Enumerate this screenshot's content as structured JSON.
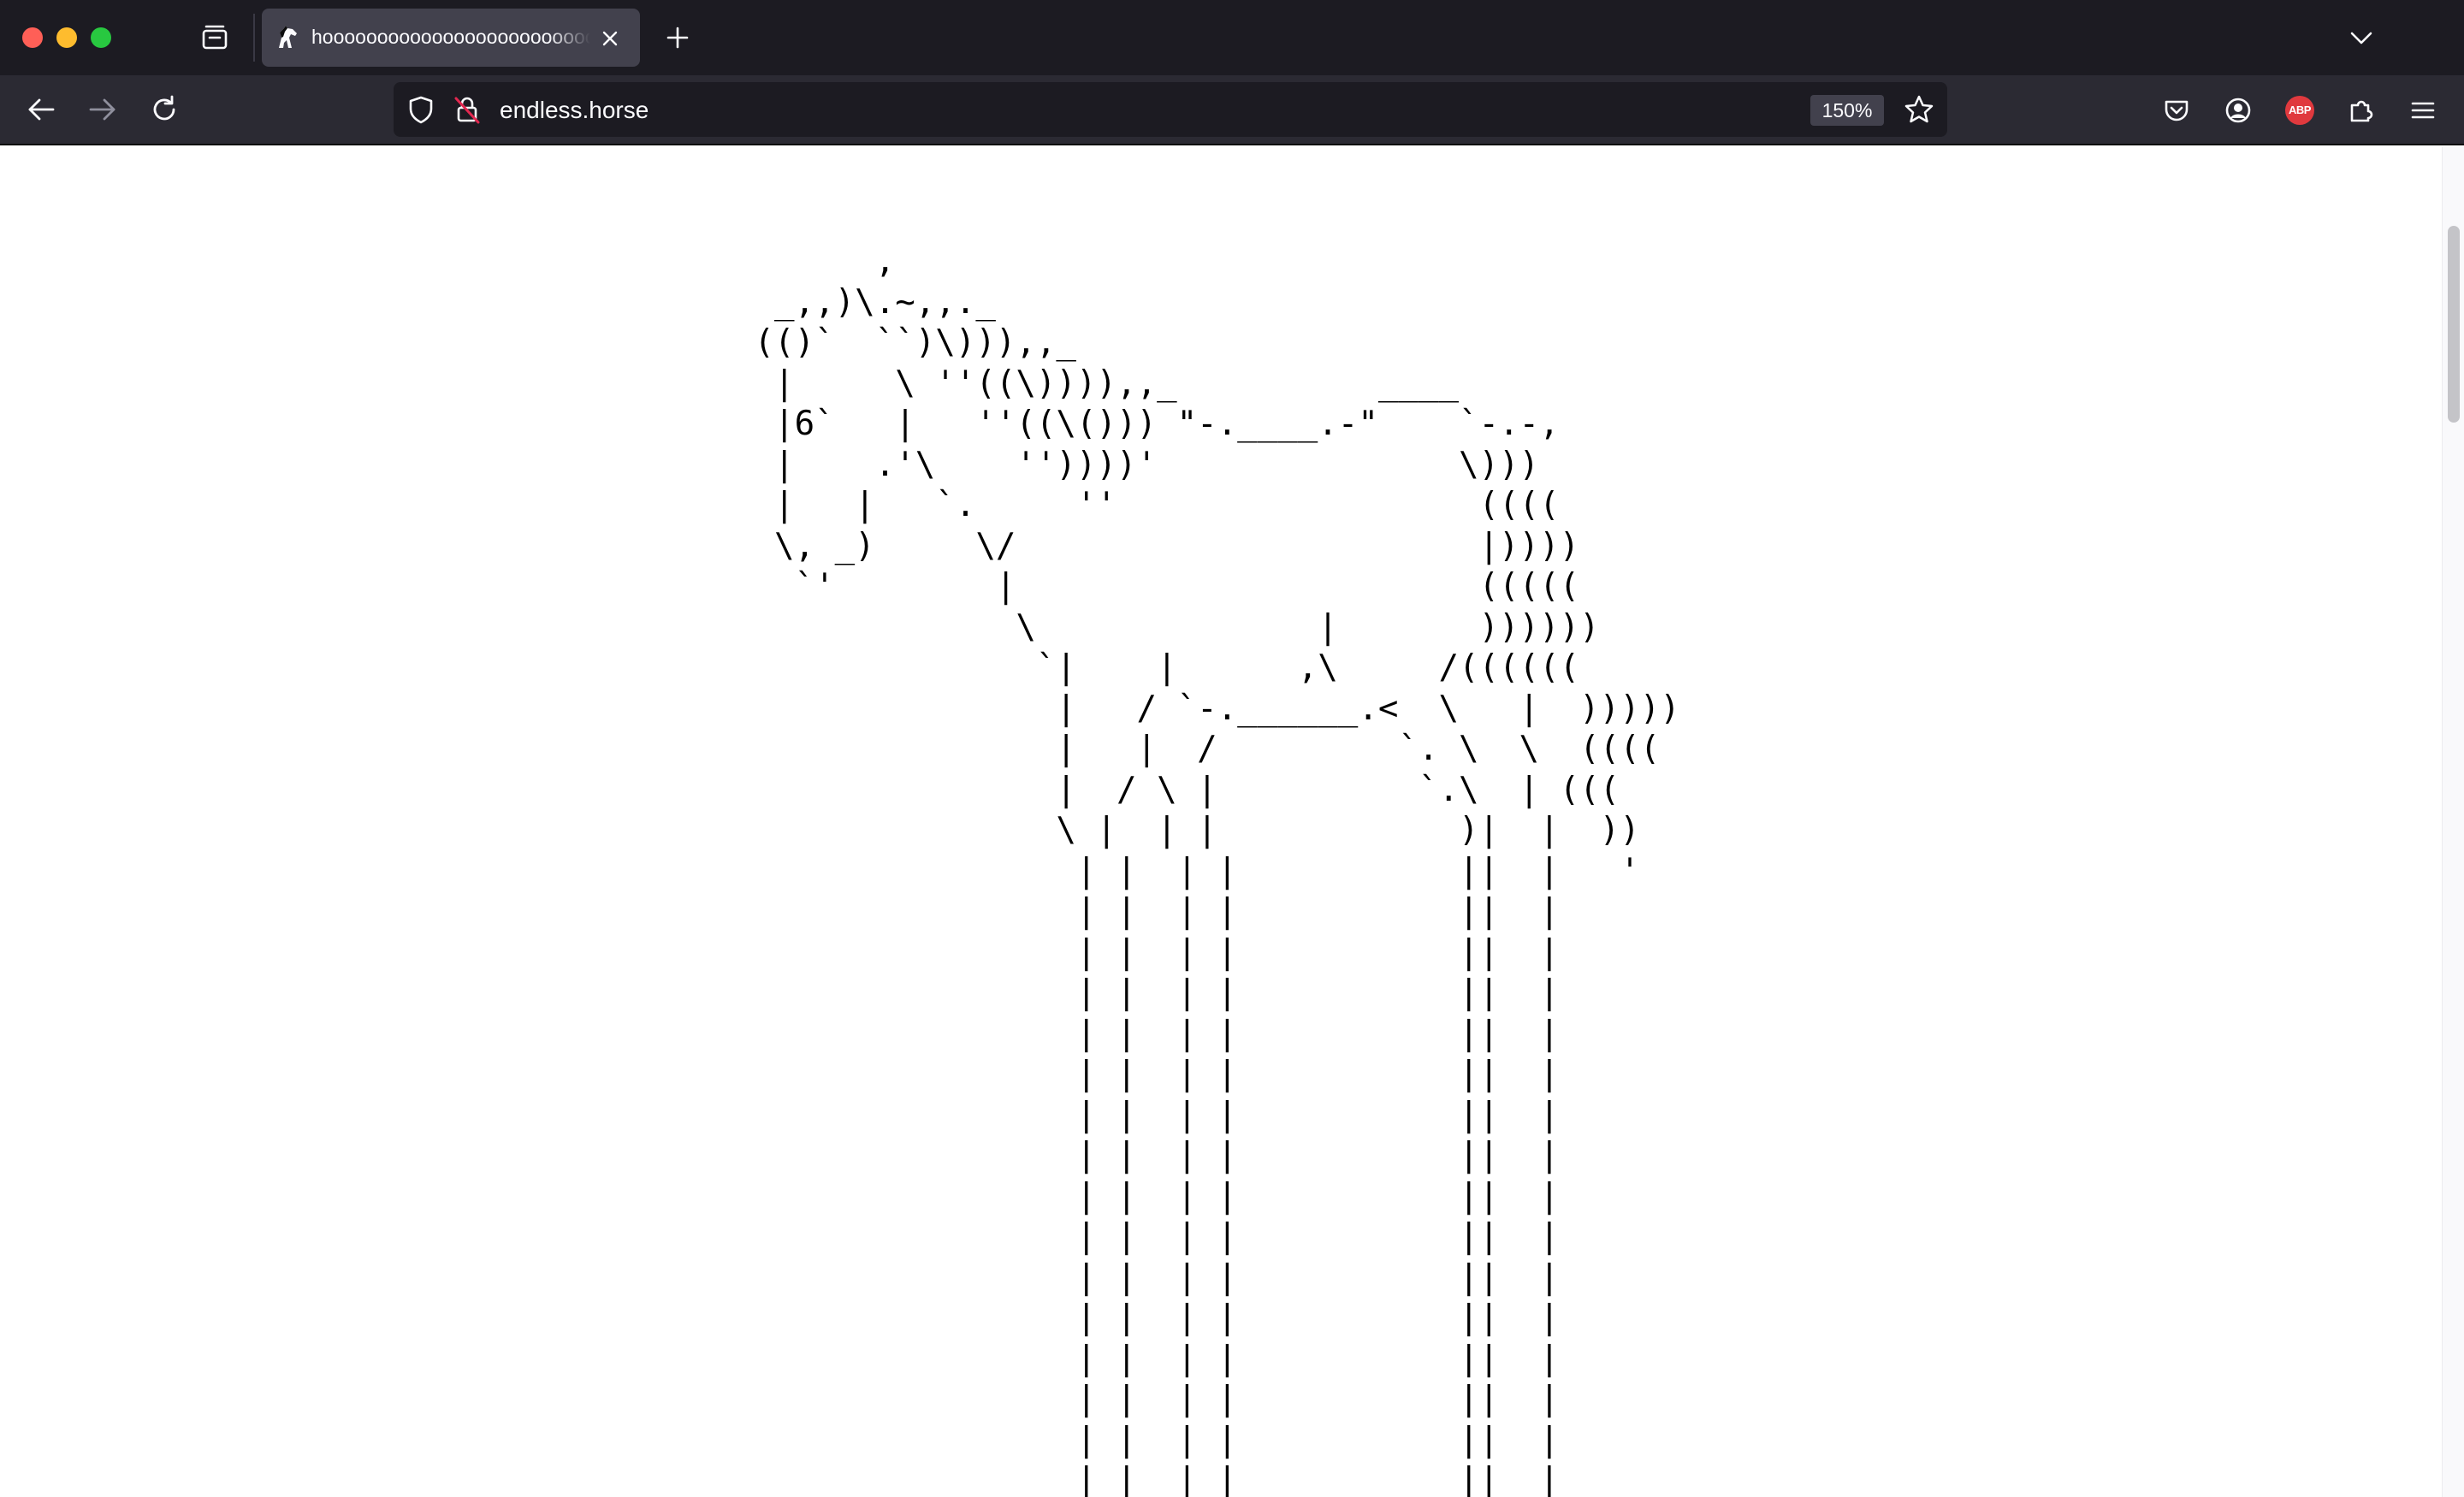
{
  "browser": {
    "tab": {
      "title": "hooooooooooooooooooooooooooooooooooooorse"
    },
    "url": "endless.horse",
    "zoom": "150%",
    "extension_badge": "ABP"
  },
  "page": {
    "art_lines": [
      "       ,",
      "  _,,)\\.~,,._",
      " (()`  ``)\\))),,_",
      "  |     \\ ''((\\)))),,_          ____",
      "  |6`   |   ''((\\())) \"-.____.-\"    `-.-,",
      "  |    .'\\    ''))))'               \\)))",
      "  |   |   `.     ''                  ((((",
      "  \\, _)     \\/                       |))))",
      "   `'        |                       (((((",
      "              \\              |       ))))))",
      "               `|    |      ,\\     /((((((",
      "                |   / `-.______.<  \\   |  )))))",
      "                |   |  /         `. \\  \\  ((((",
      "                |  / \\ |          `.\\  | (((",
      "                \\ |  | |            )|  |  ))",
      "                 | |  | |           ||  |   '",
      "                 | |  | |           ||  |",
      "                 | |  | |           ||  |",
      "                 | |  | |           ||  |",
      "                 | |  | |           ||  |",
      "                 | |  | |           ||  |",
      "                 | |  | |           ||  |",
      "                 | |  | |           ||  |",
      "                 | |  | |           ||  |",
      "                 | |  | |           ||  |",
      "                 | |  | |           ||  |",
      "                 | |  | |           ||  |",
      "                 | |  | |           ||  |",
      "                 | |  | |           ||  |",
      "                 | |  | |           ||  |",
      "                 | |  | |           ||  |",
      "                 | |  | |           ||  |"
    ]
  },
  "icons": {
    "tab_manager": "tab-manager-icon",
    "favicon": "horse-favicon-icon",
    "close": "close-icon",
    "new_tab": "plus-icon",
    "list_all_tabs": "chevron-down-icon",
    "back": "back-arrow-icon",
    "forward": "forward-arrow-icon",
    "reload": "reload-icon",
    "tracking": "shield-icon",
    "connection": "insecure-lock-icon",
    "bookmark": "star-icon",
    "pocket": "pocket-icon",
    "account": "account-icon",
    "extensions": "puzzle-icon",
    "menu": "hamburger-menu-icon"
  },
  "colors": {
    "chrome_dark": "#1c1b22",
    "toolbar": "#2b2a33",
    "active_tab": "#42414d",
    "text": "#fbfbfe",
    "abp_red": "#e0393e",
    "insecure_red": "#e22850"
  }
}
